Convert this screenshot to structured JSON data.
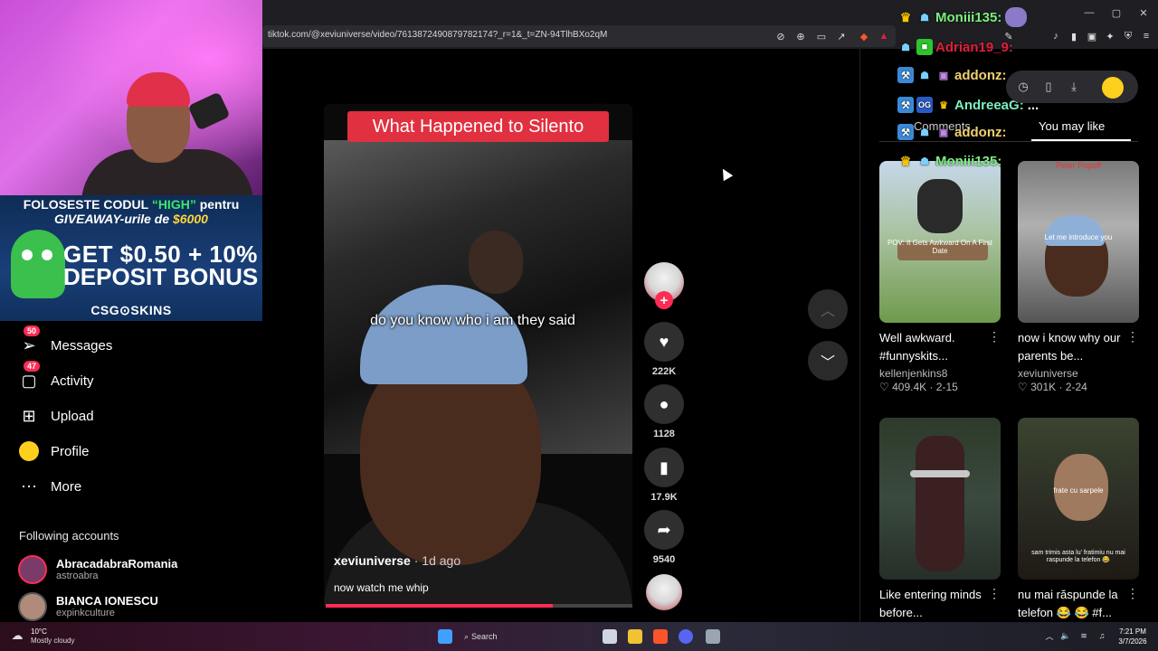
{
  "browser": {
    "url": "tiktok.com/@xeviuniverse/video/7613872490879782174?_r=1&_t=ZN-94TlhBXo2qM",
    "window_controls": [
      "—",
      "▢",
      "✕"
    ]
  },
  "overlay": {
    "promo_line1_a": "FOLOSESTE CODUL ",
    "promo_line1_code": "“HIGH”",
    "promo_line1_b": " pentru",
    "promo_line2_a": "GIVEAWAY-urile de ",
    "promo_line2_amount": "$6000",
    "promo_big1": "GET $0.50 + 10%",
    "promo_big2": "DEPOSIT BONUS",
    "promo_logo": "CSG⊙SKINS"
  },
  "sidebar": {
    "items": [
      {
        "label": "Messages",
        "badge": "50",
        "icon": "paper-plane-icon"
      },
      {
        "label": "Activity",
        "badge": "47",
        "icon": "inbox-icon"
      },
      {
        "label": "Upload",
        "icon": "plus-square-icon"
      },
      {
        "label": "Profile",
        "icon": "avatar-icon"
      },
      {
        "label": "More",
        "icon": "dots-icon"
      }
    ],
    "following_title": "Following accounts",
    "accounts": [
      {
        "name": "AbracadabraRomania",
        "handle": "astroabra"
      },
      {
        "name": "BIANCA IONESCU",
        "handle": "expinkculture"
      }
    ]
  },
  "video": {
    "title": "What Happened to Silento",
    "caption": "do you know who i am they said",
    "author": "xeviuniverse",
    "ago": " · 1d ago",
    "description": "now watch me whip",
    "progress": 0.74
  },
  "actions": {
    "likes": "222K",
    "comments": "1128",
    "saves": "17.9K",
    "shares": "9540"
  },
  "right_panel": {
    "tab_comments": "Comments",
    "tab_like": "You may like",
    "cards": [
      {
        "title": "Well awkward. #funnyskits...",
        "author": "kellenjenkins8",
        "likes": "♡ 409.4K",
        "date": "2-15",
        "thumb_text": "POV: It Gets Awkward On A First Date"
      },
      {
        "title": "now i know why our parents be...",
        "author": "xeviuniverse",
        "likes": "♡ 301K",
        "date": "2-24",
        "thumb_text": "Let me introduce you",
        "thumb_top": "Peter Popoff"
      },
      {
        "title": "Like entering minds before...",
        "author": "",
        "likes": "",
        "date": "",
        "thumb_text": ""
      },
      {
        "title": "nu mai răspunde la telefon 😂 😂 #f...",
        "author": "",
        "likes": "",
        "date": "",
        "thumb_text": "frate cu sarpele",
        "thumb_text2": "sam trimis asta lu' fratimiu nu mai raspunde la telefon 😂"
      }
    ]
  },
  "chat": [
    {
      "user": "Moniii135:",
      "color": "#7cf07c",
      "msg": ""
    },
    {
      "user": "Adrian19_9:",
      "color": "#e0203a",
      "msg": ""
    },
    {
      "user": "addonz:",
      "color": "#f0d070",
      "msg": ""
    },
    {
      "user": "AndreeaG:",
      "color": "#7cf0c0",
      "msg": "..."
    },
    {
      "user": "addonz:",
      "color": "#f0d070",
      "msg": ""
    },
    {
      "user": "Moniii135:",
      "color": "#7cf07c",
      "msg": ""
    }
  ],
  "taskbar": {
    "weather_temp": "10°C",
    "weather_desc": "Mostly cloudy",
    "search": "Search",
    "time": "7:21 PM",
    "date": "3/7/2026"
  },
  "colors": {
    "accent": "#fe2c55",
    "title_red": "#e1303f"
  }
}
